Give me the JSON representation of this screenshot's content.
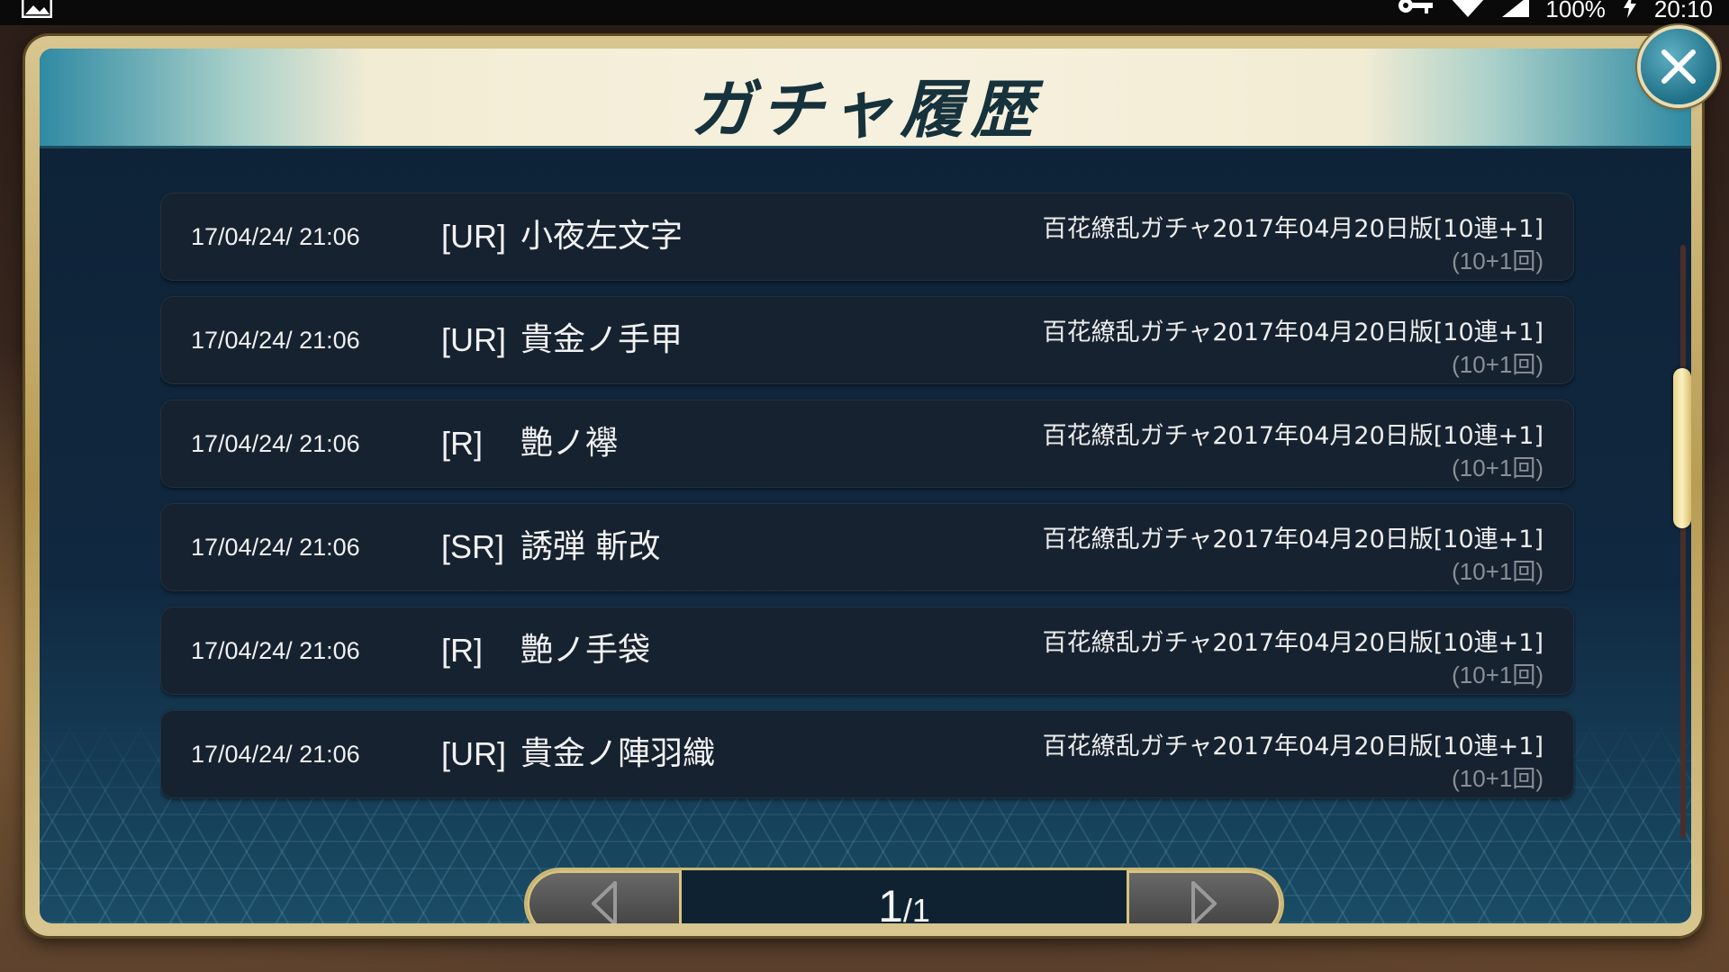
{
  "status_bar": {
    "battery": "100%",
    "time": "20:10"
  },
  "dialog": {
    "title": "ガチャ履歴"
  },
  "history": [
    {
      "date": "17/04/24/ 21:06",
      "rarity": "[UR]",
      "item": "小夜左文字",
      "gacha": "百花繚乱ガチャ2017年04月20日版[10連+1]",
      "count": "(10+1回)"
    },
    {
      "date": "17/04/24/ 21:06",
      "rarity": "[UR]",
      "item": "貴金ノ手甲",
      "gacha": "百花繚乱ガチャ2017年04月20日版[10連+1]",
      "count": "(10+1回)"
    },
    {
      "date": "17/04/24/ 21:06",
      "rarity": "[R]",
      "item": "艶ノ襷",
      "gacha": "百花繚乱ガチャ2017年04月20日版[10連+1]",
      "count": "(10+1回)"
    },
    {
      "date": "17/04/24/ 21:06",
      "rarity": "[SR]",
      "item": "誘弾 斬改",
      "gacha": "百花繚乱ガチャ2017年04月20日版[10連+1]",
      "count": "(10+1回)"
    },
    {
      "date": "17/04/24/ 21:06",
      "rarity": "[R]",
      "item": "艶ノ手袋",
      "gacha": "百花繚乱ガチャ2017年04月20日版[10連+1]",
      "count": "(10+1回)"
    },
    {
      "date": "17/04/24/ 21:06",
      "rarity": "[UR]",
      "item": "貴金ノ陣羽織",
      "gacha": "百花繚乱ガチャ2017年04月20日版[10連+1]",
      "count": "(10+1回)"
    }
  ],
  "pager": {
    "current": "1",
    "separator": "/",
    "total": "1"
  },
  "icons": {
    "close": "close-icon",
    "prev": "triangle-left-icon",
    "next": "triangle-right-icon",
    "gallery": "image-icon",
    "key": "key-icon",
    "wifi": "wifi-icon",
    "signal": "signal-icon",
    "charging": "bolt-icon"
  },
  "colors": {
    "accent_gold": "#d8c37e",
    "panel_dark": "#172230",
    "title_ink": "#16323c"
  }
}
